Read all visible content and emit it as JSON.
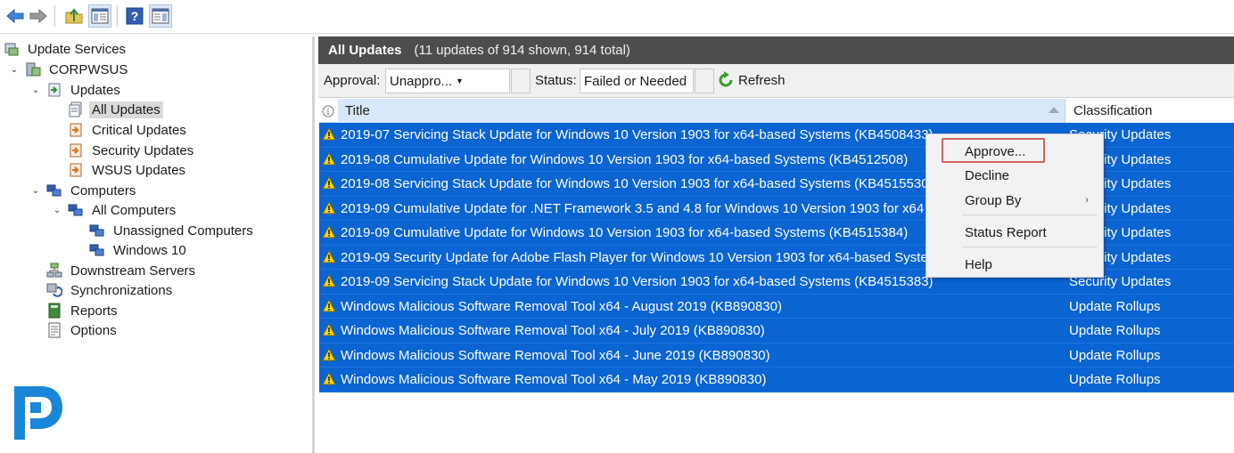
{
  "toolbar": {
    "buttons": [
      "back-arrow-icon",
      "forward-arrow-icon",
      "up-folder-icon",
      "show-hide-tree-icon",
      "help-icon",
      "action-pane-icon"
    ]
  },
  "tree": {
    "root": "Update Services",
    "server": "CORPWSUS",
    "updates": "Updates",
    "all_updates": "All Updates",
    "critical_updates": "Critical Updates",
    "security_updates": "Security Updates",
    "wsus_updates": "WSUS Updates",
    "computers": "Computers",
    "all_computers": "All Computers",
    "unassigned_computers": "Unassigned Computers",
    "windows10": "Windows 10",
    "downstream_servers": "Downstream Servers",
    "synchronizations": "Synchronizations",
    "reports": "Reports",
    "options": "Options"
  },
  "header": {
    "title": "All Updates",
    "count": "(11 updates of 914 shown, 914 total)"
  },
  "filters": {
    "approval_label": "Approval:",
    "approval_value": "Unappro...",
    "status_label": "Status:",
    "status_value": "Failed or Needed",
    "refresh_label": "Refresh"
  },
  "columns": {
    "title": "Title",
    "classification": "Classification"
  },
  "rows": [
    {
      "title": "2019-07 Servicing Stack Update for Windows 10 Version 1903 for x64-based Systems (KB4508433)",
      "classification": "Security Updates"
    },
    {
      "title": "2019-08 Cumulative Update for Windows 10 Version 1903 for x64-based Systems (KB4512508)",
      "classification": "Security Updates"
    },
    {
      "title": "2019-08 Servicing Stack Update for Windows 10 Version 1903 for x64-based Systems (KB4515530)",
      "classification": "Security Updates"
    },
    {
      "title": "2019-09 Cumulative Update for .NET Framework 3.5 and 4.8 for Windows 10 Version 1903 for x64 (KB4514359)",
      "classification": "Security Updates"
    },
    {
      "title": "2019-09 Cumulative Update for Windows 10 Version 1903 for x64-based Systems (KB4515384)",
      "classification": "Security Updates"
    },
    {
      "title": "2019-09 Security Update for Adobe Flash Player for Windows 10 Version 1903 for x64-based Systems (KB4516115)",
      "classification": "Security Updates"
    },
    {
      "title": "2019-09 Servicing Stack Update for Windows 10 Version 1903 for x64-based Systems (KB4515383)",
      "classification": "Security Updates"
    },
    {
      "title": "Windows Malicious Software Removal Tool x64 - August 2019 (KB890830)",
      "classification": "Update Rollups"
    },
    {
      "title": "Windows Malicious Software Removal Tool x64 - July 2019 (KB890830)",
      "classification": "Update Rollups"
    },
    {
      "title": "Windows Malicious Software Removal Tool x64 - June 2019 (KB890830)",
      "classification": "Update Rollups"
    },
    {
      "title": "Windows Malicious Software Removal Tool x64 - May 2019 (KB890830)",
      "classification": "Update Rollups"
    }
  ],
  "context_menu": {
    "approve": "Approve...",
    "decline": "Decline",
    "group_by": "Group By",
    "submenu_arrow": "›",
    "status_report": "Status Report",
    "help": "Help"
  },
  "colors": {
    "selection": "#0a64d2",
    "header_bar": "#4d4d4d",
    "highlight_box": "#d0625b"
  }
}
